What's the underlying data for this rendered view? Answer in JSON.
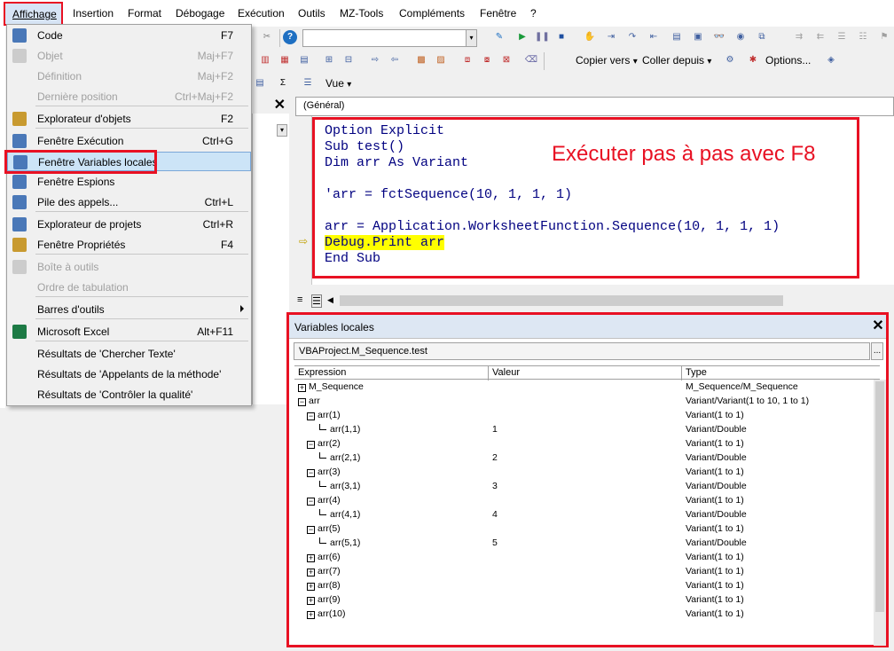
{
  "menubar": {
    "items": [
      "Affichage",
      "Insertion",
      "Format",
      "Débogage",
      "Exécution",
      "Outils",
      "MZ-Tools",
      "Compléments",
      "Fenêtre",
      "?"
    ]
  },
  "toolbar": {
    "copy_to": "Copier vers",
    "paste_from": "Coller depuis",
    "options": "Options...",
    "view": "Vue",
    "caret": "▾"
  },
  "code": {
    "object_combo": "(Général)",
    "lines": [
      "Option Explicit",
      "Sub test()",
      "Dim arr As Variant",
      "",
      "'arr = fctSequence(10, 1, 1, 1)",
      "",
      "arr = Application.WorksheetFunction.Sequence(10, 1, 1, 1)",
      "Debug.Print arr",
      "End Sub"
    ],
    "annotation": "Exécuter pas à pas avec F8"
  },
  "locals": {
    "title": "Variables locales",
    "context": "VBAProject.M_Sequence.test",
    "context_button": "...",
    "close": "✕",
    "columns": [
      "Expression",
      "Valeur",
      "Type"
    ],
    "rows": [
      {
        "expr": "M_Sequence",
        "value": "",
        "type": "M_Sequence/M_Sequence",
        "level": 0,
        "box": "+"
      },
      {
        "expr": "arr",
        "value": "",
        "type": "Variant/Variant(1 to 10, 1 to 1)",
        "level": 0,
        "box": "−"
      },
      {
        "expr": "arr(1)",
        "value": "",
        "type": "Variant(1 to 1)",
        "level": 1,
        "box": "−"
      },
      {
        "expr": "arr(1,1)",
        "value": "1",
        "type": "Variant/Double",
        "level": 2,
        "box": ""
      },
      {
        "expr": "arr(2)",
        "value": "",
        "type": "Variant(1 to 1)",
        "level": 1,
        "box": "−"
      },
      {
        "expr": "arr(2,1)",
        "value": "2",
        "type": "Variant/Double",
        "level": 2,
        "box": ""
      },
      {
        "expr": "arr(3)",
        "value": "",
        "type": "Variant(1 to 1)",
        "level": 1,
        "box": "−"
      },
      {
        "expr": "arr(3,1)",
        "value": "3",
        "type": "Variant/Double",
        "level": 2,
        "box": ""
      },
      {
        "expr": "arr(4)",
        "value": "",
        "type": "Variant(1 to 1)",
        "level": 1,
        "box": "−"
      },
      {
        "expr": "arr(4,1)",
        "value": "4",
        "type": "Variant/Double",
        "level": 2,
        "box": ""
      },
      {
        "expr": "arr(5)",
        "value": "",
        "type": "Variant(1 to 1)",
        "level": 1,
        "box": "−"
      },
      {
        "expr": "arr(5,1)",
        "value": "5",
        "type": "Variant/Double",
        "level": 2,
        "box": ""
      },
      {
        "expr": "arr(6)",
        "value": "",
        "type": "Variant(1 to 1)",
        "level": 1,
        "box": "+"
      },
      {
        "expr": "arr(7)",
        "value": "",
        "type": "Variant(1 to 1)",
        "level": 1,
        "box": "+"
      },
      {
        "expr": "arr(8)",
        "value": "",
        "type": "Variant(1 to 1)",
        "level": 1,
        "box": "+"
      },
      {
        "expr": "arr(9)",
        "value": "",
        "type": "Variant(1 to 1)",
        "level": 1,
        "box": "+"
      },
      {
        "expr": "arr(10)",
        "value": "",
        "type": "Variant(1 to 1)",
        "level": 1,
        "box": "+"
      }
    ]
  },
  "dropdown": {
    "items": [
      {
        "label": "Code",
        "shortcut": "F7",
        "disabled": false,
        "icon": "code-icon"
      },
      {
        "label": "Objet",
        "shortcut": "Maj+F7",
        "disabled": true,
        "icon": "object-icon"
      },
      {
        "label": "Définition",
        "shortcut": "Maj+F2",
        "disabled": true,
        "icon": ""
      },
      {
        "label": "Dernière position",
        "shortcut": "Ctrl+Maj+F2",
        "disabled": true,
        "icon": ""
      },
      {
        "label": "Explorateur d'objets",
        "shortcut": "F2",
        "disabled": false,
        "icon": "object-browser-icon"
      },
      {
        "label": "Fenêtre Exécution",
        "shortcut": "Ctrl+G",
        "disabled": false,
        "icon": "immediate-window-icon"
      },
      {
        "label": "Fenêtre Variables locales",
        "shortcut": "",
        "disabled": false,
        "icon": "locals-window-icon"
      },
      {
        "label": "Fenêtre Espions",
        "shortcut": "",
        "disabled": false,
        "icon": "watch-window-icon"
      },
      {
        "label": "Pile des appels...",
        "shortcut": "Ctrl+L",
        "disabled": false,
        "icon": "call-stack-icon"
      },
      {
        "label": "Explorateur de projets",
        "shortcut": "Ctrl+R",
        "disabled": false,
        "icon": "project-explorer-icon"
      },
      {
        "label": "Fenêtre Propriétés",
        "shortcut": "F4",
        "disabled": false,
        "icon": "properties-icon"
      },
      {
        "label": "Boîte à outils",
        "shortcut": "",
        "disabled": true,
        "icon": "toolbox-icon"
      },
      {
        "label": "Ordre de tabulation",
        "shortcut": "",
        "disabled": true,
        "icon": ""
      },
      {
        "label": "Barres d'outils",
        "shortcut": "",
        "disabled": false,
        "icon": ""
      },
      {
        "label": "Microsoft Excel",
        "shortcut": "Alt+F11",
        "disabled": false,
        "icon": "excel-icon"
      },
      {
        "label": "Résultats de 'Chercher Texte'",
        "shortcut": "",
        "disabled": false,
        "icon": ""
      },
      {
        "label": "Résultats de 'Appelants de la méthode'",
        "shortcut": "",
        "disabled": false,
        "icon": ""
      },
      {
        "label": "Résultats de 'Contrôler la qualité'",
        "shortcut": "",
        "disabled": false,
        "icon": ""
      }
    ]
  },
  "colors": {
    "highlight_red": "#e81123",
    "code_blue": "#000080",
    "exec_yellow": "#ffff00",
    "selection_blue": "#cce4f7"
  }
}
